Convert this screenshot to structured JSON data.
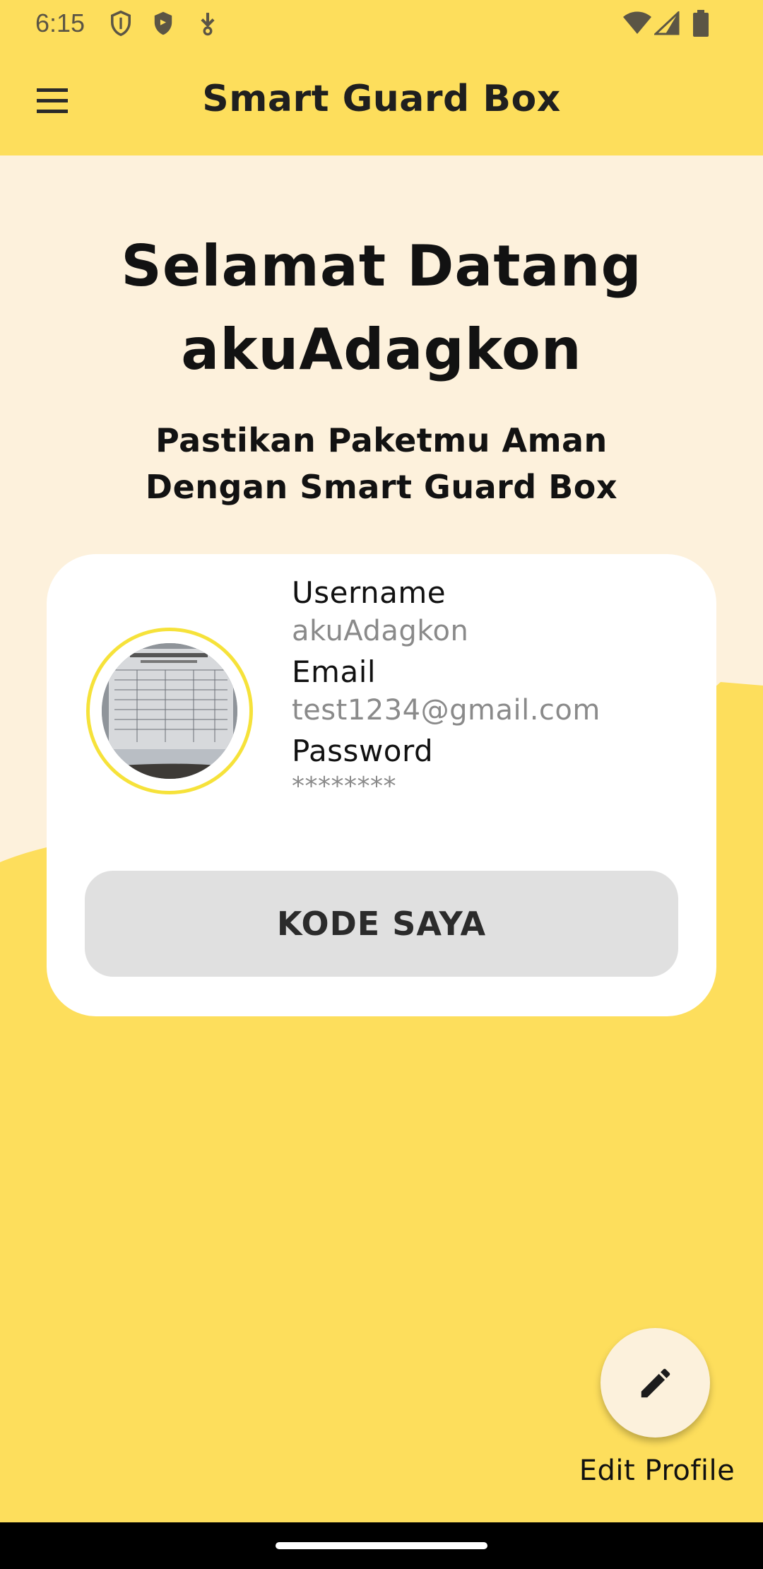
{
  "status_bar": {
    "time": "6:15",
    "icons": [
      "shield-outline-icon",
      "shield-filled-icon",
      "download-arrow-icon",
      "wifi-icon",
      "cell-signal-icon",
      "battery-icon"
    ]
  },
  "app_bar": {
    "menu_icon": "hamburger-menu-icon",
    "title": "Smart Guard Box"
  },
  "welcome": {
    "line1": "Selamat Datang",
    "line2": "akuAdagkon",
    "subtitle_line1": "Pastikan Paketmu Aman",
    "subtitle_line2": "Dengan Smart Guard Box"
  },
  "profile": {
    "username_label": "Username",
    "username_value": "akuAdagkon",
    "email_label": "Email",
    "email_value": "test1234@gmail.com",
    "password_label": "Password",
    "password_value": "********",
    "kode_button": "KODE SAYA"
  },
  "fab": {
    "icon": "pencil-icon",
    "label": "Edit Profile"
  },
  "colors": {
    "primary_yellow": "#FDDE5C",
    "cream": "#FDF1DC",
    "card": "#FFFFFF",
    "button_gray": "#E0E0E0",
    "avatar_ring": "#F6E23A"
  }
}
